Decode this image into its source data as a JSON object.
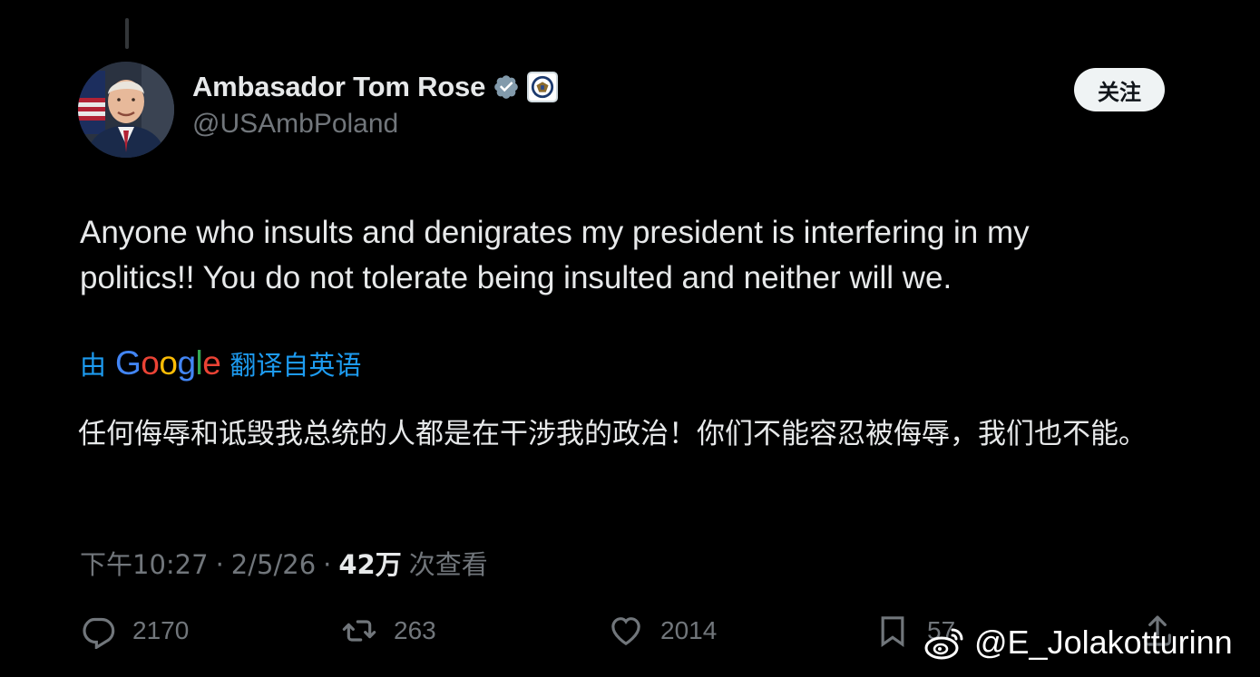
{
  "author": {
    "display_name": "Ambasador Tom Rose",
    "handle": "@USAmbPoland",
    "verified": true,
    "affiliation": "seal-icon"
  },
  "follow_button": {
    "label": "关注"
  },
  "tweet": {
    "text": "Anyone who insults and denigrates my president is interfering in my politics!! You do not tolerate being insulted and neither will we.",
    "translation_prefix": "由",
    "translation_provider": "Google",
    "translation_suffix": "翻译自英语",
    "translated_text": "任何侮辱和诋毁我总统的人都是在干涉我的政治！你们不能容忍被侮辱，我们也不能。"
  },
  "meta": {
    "time": "下午10:27",
    "separator": "·",
    "date": "2/5/26",
    "views_count": "42万",
    "views_label": "次查看"
  },
  "actions": {
    "replies": "2170",
    "retweets": "263",
    "likes": "2014",
    "bookmarks": "57"
  },
  "watermark": {
    "text": "@E_Jolakotturinn"
  },
  "colors": {
    "background": "#000000",
    "text_primary": "#e7e9ea",
    "text_secondary": "#71767b",
    "link": "#1d9bf0",
    "verified": "#829aab"
  }
}
